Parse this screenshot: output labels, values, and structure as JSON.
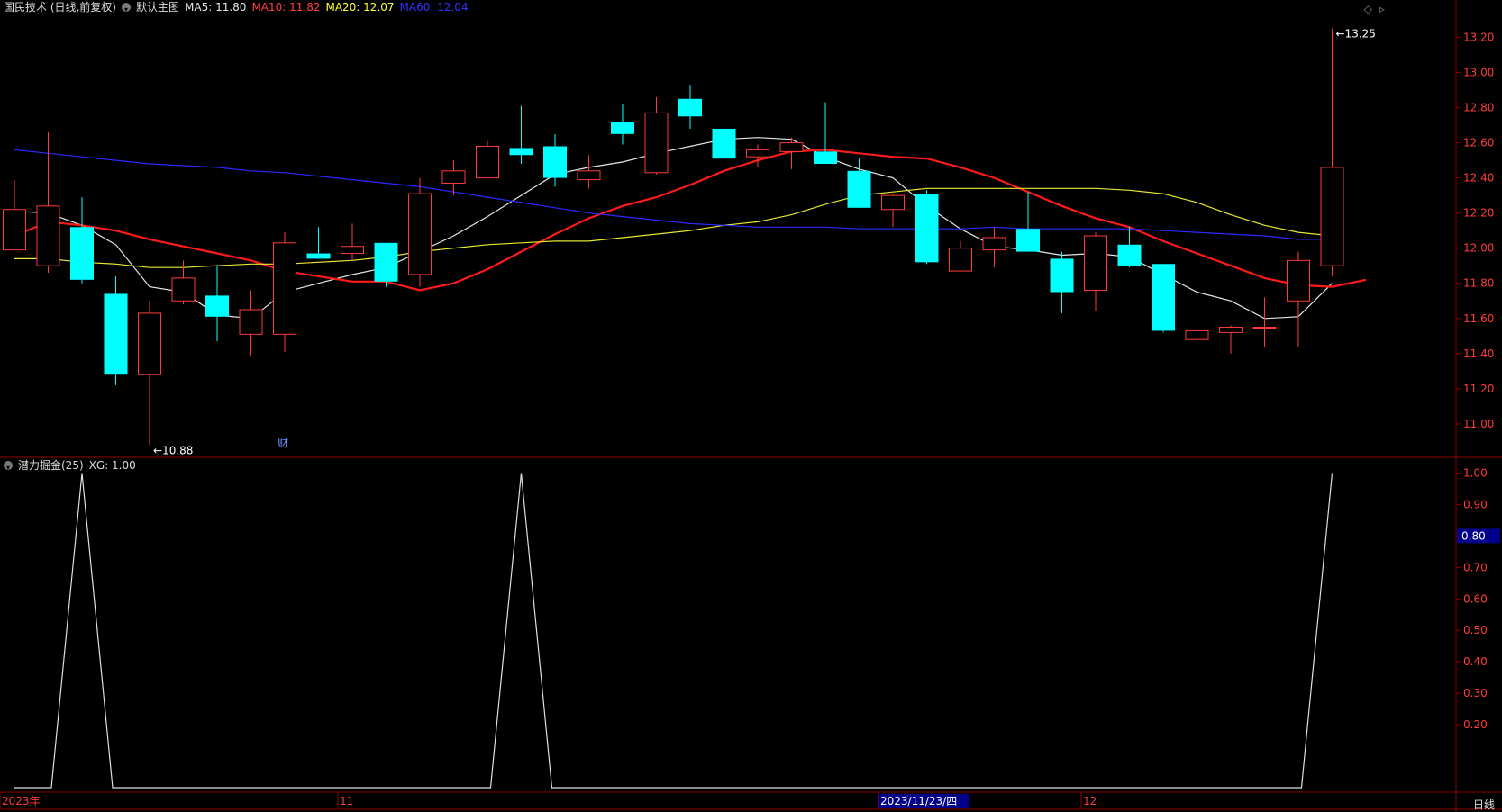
{
  "header": {
    "stock_title": "国民技术 (日线,前复权)",
    "main_chart_label": "默认主图",
    "ma5_label": "MA5: 11.80",
    "ma10_label": "MA10: 11.82",
    "ma20_label": "MA20: 12.07",
    "ma60_label": "MA60: 12.04",
    "indicator_label": "潜力掘金(25)",
    "xg_label": "XG: 1.00"
  },
  "period": "日线",
  "colors": {
    "up": "#ff3b3b",
    "down": "#00ffff",
    "ma5": "#e6e6e6",
    "ma10": "#ff1a1a",
    "ma20": "#e6e633",
    "ma60": "#2a2aff",
    "axis": "#8b0000",
    "label_red": "#ff4040",
    "label_yellow": "#ffff33",
    "label_blue": "#3333ff",
    "highlight": "#00008b"
  },
  "chart_data": [
    {
      "type": "candlestick",
      "ylim": [
        10.82,
        13.31
      ],
      "y_ticks": [
        "13.20",
        "13.00",
        "12.80",
        "12.60",
        "12.40",
        "12.20",
        "12.00",
        "11.80",
        "11.60",
        "11.40",
        "11.20",
        "11.00"
      ],
      "y_tick_values": [
        13.2,
        13.0,
        12.8,
        12.6,
        12.4,
        12.2,
        12.0,
        11.8,
        11.6,
        11.4,
        11.2,
        11.0
      ],
      "x_labels": [
        {
          "label": "2023年",
          "index": 0
        },
        {
          "label": "11",
          "index": 10
        },
        {
          "label": "2023/11/23/四",
          "index": 26
        },
        {
          "label": "12",
          "index": 32
        }
      ],
      "annotations": [
        {
          "text": "13.25",
          "index": 39,
          "value": 13.25
        },
        {
          "text": "10.88",
          "index": 4,
          "value": 10.88
        },
        {
          "text": "财",
          "index": 8
        }
      ],
      "ohlc": [
        {
          "o": 11.99,
          "h": 12.39,
          "l": 11.99,
          "c": 12.22
        },
        {
          "o": 11.9,
          "h": 12.66,
          "l": 11.86,
          "c": 12.24
        },
        {
          "o": 12.12,
          "h": 12.29,
          "l": 11.8,
          "c": 11.82
        },
        {
          "o": 11.74,
          "h": 11.84,
          "l": 11.22,
          "c": 11.28
        },
        {
          "o": 11.28,
          "h": 11.7,
          "l": 10.88,
          "c": 11.63
        },
        {
          "o": 11.7,
          "h": 11.93,
          "l": 11.68,
          "c": 11.83
        },
        {
          "o": 11.73,
          "h": 11.9,
          "l": 11.47,
          "c": 11.61
        },
        {
          "o": 11.51,
          "h": 11.76,
          "l": 11.39,
          "c": 11.65
        },
        {
          "o": 11.51,
          "h": 12.09,
          "l": 11.41,
          "c": 12.03
        },
        {
          "o": 11.97,
          "h": 12.12,
          "l": 11.94,
          "c": 11.94
        },
        {
          "o": 11.97,
          "h": 12.14,
          "l": 11.93,
          "c": 12.01
        },
        {
          "o": 12.03,
          "h": 12.03,
          "l": 11.78,
          "c": 11.81
        },
        {
          "o": 11.85,
          "h": 12.4,
          "l": 11.78,
          "c": 12.31
        },
        {
          "o": 12.37,
          "h": 12.5,
          "l": 12.3,
          "c": 12.44
        },
        {
          "o": 12.4,
          "h": 12.61,
          "l": 12.4,
          "c": 12.58
        },
        {
          "o": 12.57,
          "h": 12.81,
          "l": 12.48,
          "c": 12.53
        },
        {
          "o": 12.58,
          "h": 12.65,
          "l": 12.35,
          "c": 12.4
        },
        {
          "o": 12.39,
          "h": 12.53,
          "l": 12.34,
          "c": 12.44
        },
        {
          "o": 12.72,
          "h": 12.82,
          "l": 12.59,
          "c": 12.65
        },
        {
          "o": 12.43,
          "h": 12.86,
          "l": 12.42,
          "c": 12.77
        },
        {
          "o": 12.85,
          "h": 12.93,
          "l": 12.68,
          "c": 12.75
        },
        {
          "o": 12.68,
          "h": 12.72,
          "l": 12.49,
          "c": 12.51
        },
        {
          "o": 12.52,
          "h": 12.59,
          "l": 12.46,
          "c": 12.56
        },
        {
          "o": 12.55,
          "h": 12.63,
          "l": 12.45,
          "c": 12.6
        },
        {
          "o": 12.55,
          "h": 12.83,
          "l": 12.48,
          "c": 12.48
        },
        {
          "o": 12.44,
          "h": 12.51,
          "l": 12.23,
          "c": 12.23
        },
        {
          "o": 12.22,
          "h": 12.31,
          "l": 12.12,
          "c": 12.3
        },
        {
          "o": 12.31,
          "h": 12.33,
          "l": 11.91,
          "c": 11.92
        },
        {
          "o": 11.87,
          "h": 12.04,
          "l": 11.87,
          "c": 12.0
        },
        {
          "o": 11.99,
          "h": 12.12,
          "l": 11.89,
          "c": 12.06
        },
        {
          "o": 12.11,
          "h": 12.32,
          "l": 11.98,
          "c": 11.98
        },
        {
          "o": 11.94,
          "h": 11.98,
          "l": 11.63,
          "c": 11.75
        },
        {
          "o": 11.76,
          "h": 12.09,
          "l": 11.64,
          "c": 12.07
        },
        {
          "o": 12.02,
          "h": 12.12,
          "l": 11.89,
          "c": 11.9
        },
        {
          "o": 11.91,
          "h": 11.91,
          "l": 11.52,
          "c": 11.53
        },
        {
          "o": 11.48,
          "h": 11.66,
          "l": 11.48,
          "c": 11.53
        },
        {
          "o": 11.52,
          "h": 11.56,
          "l": 11.4,
          "c": 11.55
        },
        {
          "o": 11.55,
          "h": 11.72,
          "l": 11.44,
          "c": 11.55
        },
        {
          "o": 11.7,
          "h": 11.98,
          "l": 11.44,
          "c": 11.93
        },
        {
          "o": 11.9,
          "h": 13.25,
          "l": 11.84,
          "c": 12.46
        }
      ],
      "series": [
        {
          "name": "MA5",
          "values": [
            12.21,
            12.2,
            12.13,
            12.02,
            11.78,
            11.75,
            11.62,
            11.6,
            11.75,
            11.8,
            11.85,
            11.89,
            11.98,
            12.07,
            12.18,
            12.3,
            12.42,
            12.46,
            12.49,
            12.54,
            12.58,
            12.62,
            12.63,
            12.62,
            12.52,
            12.45,
            12.4,
            12.24,
            12.11,
            12.01,
            11.99,
            11.96,
            11.97,
            11.95,
            11.85,
            11.75,
            11.7,
            11.6,
            11.61,
            11.8
          ]
        },
        {
          "name": "MA10",
          "values": [
            12.07,
            12.15,
            12.13,
            12.1,
            12.05,
            12.01,
            11.97,
            11.93,
            11.87,
            11.84,
            11.81,
            11.81,
            11.76,
            11.8,
            11.88,
            11.98,
            12.08,
            12.17,
            12.24,
            12.29,
            12.36,
            12.44,
            12.5,
            12.55,
            12.56,
            12.54,
            12.52,
            12.51,
            12.46,
            12.4,
            12.32,
            12.24,
            12.17,
            12.12,
            12.04,
            11.97,
            11.9,
            11.83,
            11.79,
            11.78,
            11.82
          ]
        },
        {
          "name": "MA20",
          "values": [
            11.94,
            11.94,
            11.92,
            11.91,
            11.89,
            11.89,
            11.9,
            11.91,
            11.91,
            11.92,
            11.93,
            11.95,
            11.98,
            12.0,
            12.02,
            12.03,
            12.04,
            12.04,
            12.06,
            12.08,
            12.1,
            12.13,
            12.15,
            12.19,
            12.25,
            12.3,
            12.32,
            12.34,
            12.34,
            12.34,
            12.34,
            12.34,
            12.34,
            12.33,
            12.31,
            12.26,
            12.19,
            12.13,
            12.09,
            12.07
          ]
        },
        {
          "name": "MA60",
          "values": [
            12.56,
            12.54,
            12.52,
            12.5,
            12.48,
            12.47,
            12.46,
            12.44,
            12.43,
            12.41,
            12.39,
            12.37,
            12.35,
            12.32,
            12.29,
            12.26,
            12.23,
            12.2,
            12.18,
            12.16,
            12.14,
            12.13,
            12.12,
            12.12,
            12.12,
            12.11,
            12.11,
            12.11,
            12.11,
            12.12,
            12.11,
            12.11,
            12.11,
            12.11,
            12.1,
            12.09,
            12.08,
            12.07,
            12.05,
            12.05
          ]
        }
      ]
    },
    {
      "type": "line",
      "name": "XG",
      "ylim": [
        0,
        1.03
      ],
      "y_ticks": [
        "1.00",
        "0.90",
        "0.80",
        "0.70",
        "0.60",
        "0.50",
        "0.40",
        "0.30",
        "0.20"
      ],
      "y_tick_values": [
        1.0,
        0.9,
        0.8,
        0.7,
        0.6,
        0.5,
        0.4,
        0.3,
        0.2
      ],
      "crosshair_value": "0.80",
      "values": [
        0,
        0,
        1,
        0,
        0,
        0,
        0,
        0,
        0,
        0,
        0,
        0,
        0,
        0,
        0,
        1,
        0,
        0,
        0,
        0,
        0,
        0,
        0,
        0,
        0,
        0,
        0,
        0,
        0,
        0,
        0,
        0,
        0,
        0,
        0,
        0,
        0,
        0,
        0,
        1
      ]
    }
  ]
}
